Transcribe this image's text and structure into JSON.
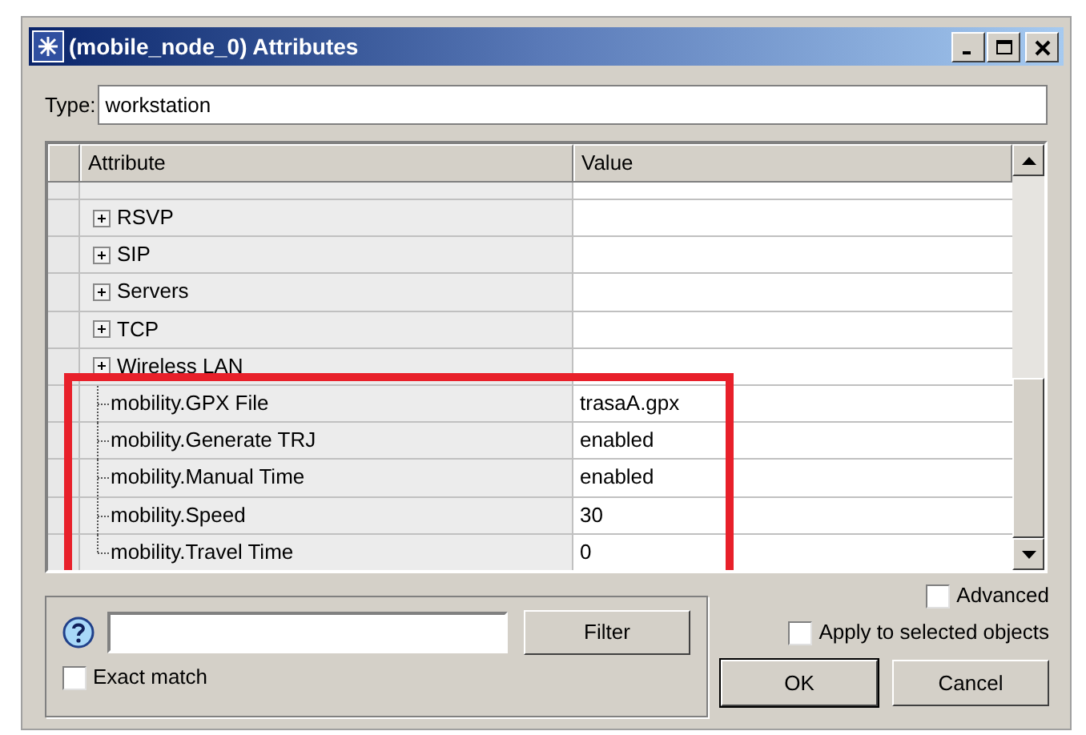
{
  "window": {
    "title": "(mobile_node_0) Attributes"
  },
  "type_field": {
    "label": "Type:",
    "value": "workstation"
  },
  "table": {
    "columns": [
      "Attribute",
      "Value"
    ],
    "rows": [
      {
        "kind": "group",
        "name": "RSVP",
        "value": "",
        "highlighted": false
      },
      {
        "kind": "group",
        "name": "SIP",
        "value": "",
        "highlighted": false
      },
      {
        "kind": "group",
        "name": "Servers",
        "value": "",
        "highlighted": false
      },
      {
        "kind": "group",
        "name": "TCP",
        "value": "",
        "highlighted": false
      },
      {
        "kind": "group",
        "name": "Wireless LAN",
        "value": "",
        "highlighted": false
      },
      {
        "kind": "leaf",
        "name": "mobility.GPX File",
        "value": "trasaA.gpx",
        "highlighted": true
      },
      {
        "kind": "leaf",
        "name": "mobility.Generate TRJ",
        "value": "enabled",
        "highlighted": true
      },
      {
        "kind": "leaf",
        "name": "mobility.Manual Time",
        "value": "enabled",
        "highlighted": true
      },
      {
        "kind": "leaf",
        "name": "mobility.Speed",
        "value": "30",
        "highlighted": true
      },
      {
        "kind": "last_leaf",
        "name": "mobility.Travel Time",
        "value": "0",
        "highlighted": true
      }
    ]
  },
  "filter": {
    "button": "Filter",
    "exact_match": {
      "label": "Exact match",
      "checked": false
    }
  },
  "advanced": {
    "label": "Advanced",
    "checked": false
  },
  "apply_to_selected": {
    "label": "Apply to selected objects",
    "checked": false
  },
  "buttons": [
    "OK",
    "Cancel"
  ]
}
